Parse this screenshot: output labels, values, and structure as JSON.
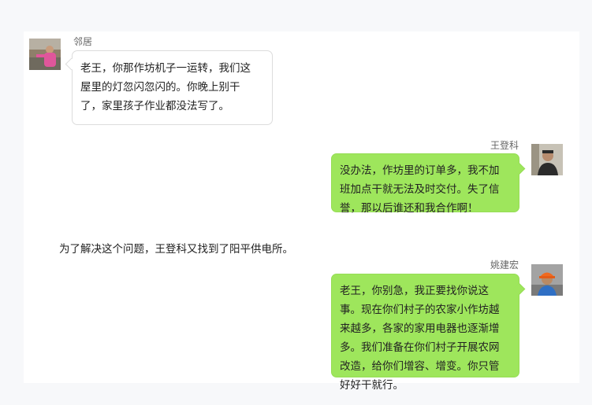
{
  "messages": [
    {
      "sender": "邻居",
      "side": "left",
      "avatar": "neighbor-avatar",
      "lines": [
        "老王，你那作坊机子一运转，我们这",
        "屋里的灯忽闪忽闪的。你晚上别干",
        "了，家里孩子作业都没法写了。"
      ]
    },
    {
      "sender": "王登科",
      "side": "right",
      "avatar": "wang-dengke-avatar",
      "lines": [
        "没办法，作坊里的订单多，我不加",
        "班加点干就无法及时交付。失了信",
        "誉，那以后谁还和我合作啊！"
      ]
    },
    {
      "sender": "姚建宏",
      "side": "right",
      "avatar": "yao-jianhong-avatar",
      "lines": [
        "老王，你别急，我正要找你说这",
        "事。现在你们村子的农家小作坊越",
        "来越多，各家的家用电器也逐渐增",
        "多。我们准备在你们村子开展农网",
        "改造，给你们增容、增变。你只管",
        "好好干就行。"
      ]
    }
  ],
  "narration": "为了解决这个问题，王登科又找到了阳平供电所。",
  "colors": {
    "page_background": "#f7f8fa",
    "panel_background": "#ffffff",
    "left_bubble": "#ffffff",
    "right_bubble": "#9ee65c",
    "name_text": "#666666",
    "body_text": "#222222"
  }
}
